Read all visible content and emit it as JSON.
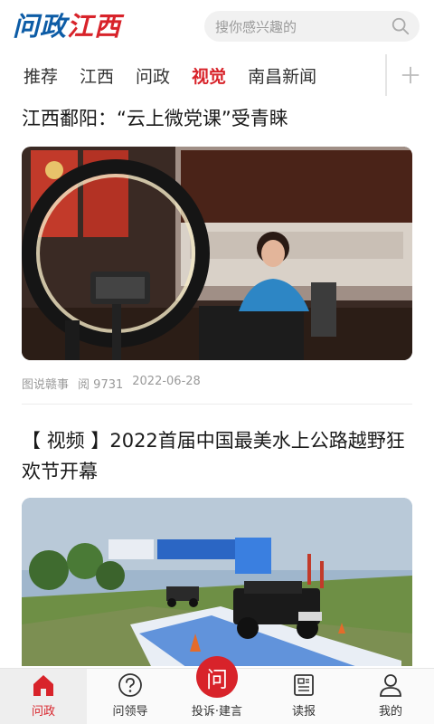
{
  "header": {
    "logo_part1": "问政",
    "logo_part2": "江西",
    "search_placeholder": "搜你感兴趣的"
  },
  "tabs": [
    {
      "label": "推荐",
      "active": false
    },
    {
      "label": "江西",
      "active": false
    },
    {
      "label": "问政",
      "active": false
    },
    {
      "label": "视觉",
      "active": true
    },
    {
      "label": "南昌新闻",
      "active": false
    }
  ],
  "articles": [
    {
      "title": "江西鄱阳：“云上微党课”受青睐",
      "source": "图说赣事",
      "views_label": "阅",
      "views": "9731",
      "date": "2022-06-28"
    },
    {
      "title": "【 视频 】2022首届中国最美水上公路越野狂欢节开幕"
    }
  ],
  "bottom_nav": [
    {
      "label": "问政",
      "icon": "home-icon",
      "active": true
    },
    {
      "label": "问领导",
      "icon": "question-icon",
      "active": false
    },
    {
      "label": "投诉·建言",
      "icon": "ask-bubble-icon",
      "bubble_char": "问",
      "active": false
    },
    {
      "label": "读报",
      "icon": "newspaper-icon",
      "active": false
    },
    {
      "label": "我的",
      "icon": "user-icon",
      "active": false
    }
  ],
  "colors": {
    "accent": "#d8232a",
    "logo_blue": "#0d5ca6"
  }
}
